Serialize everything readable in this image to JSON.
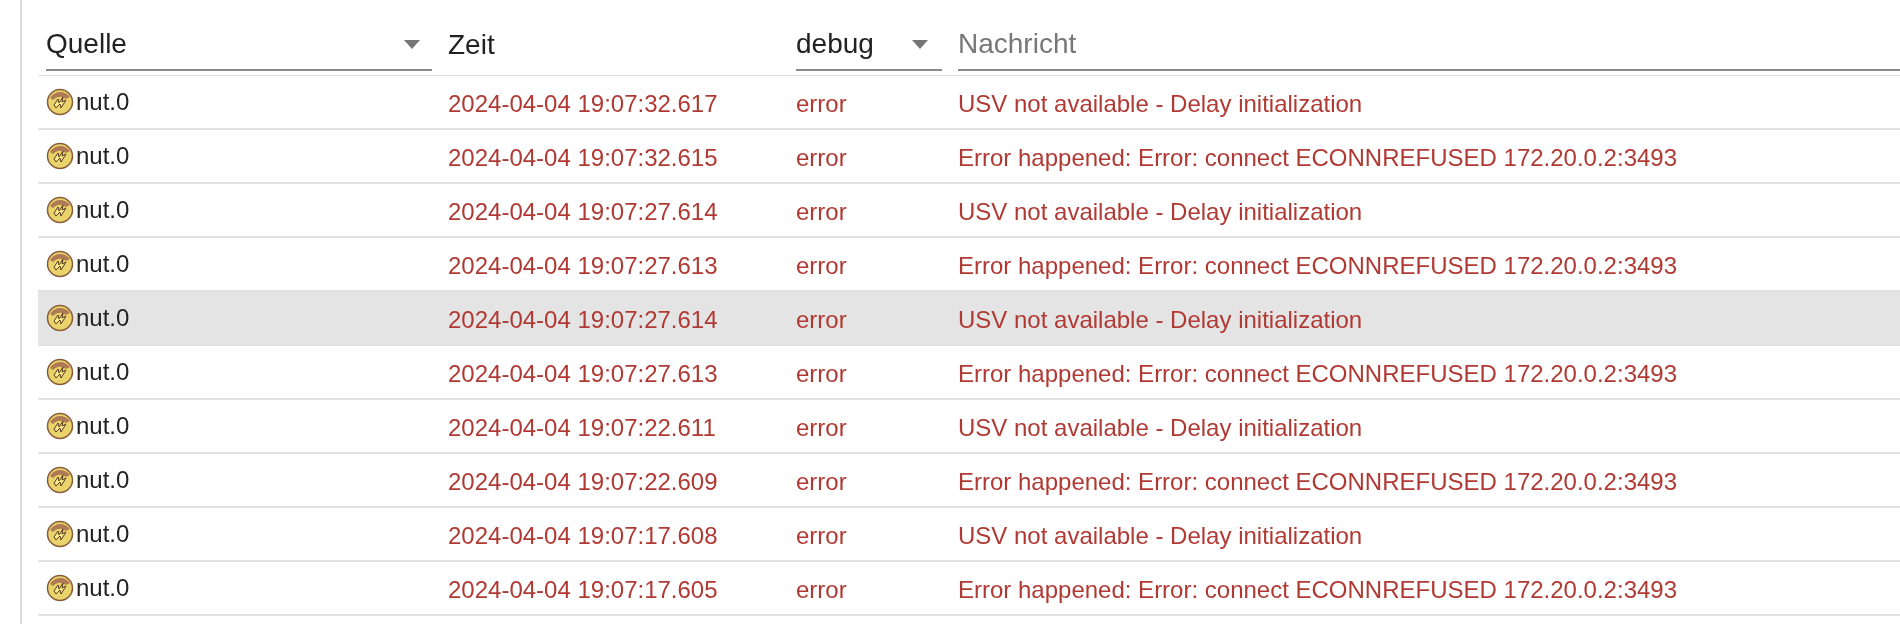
{
  "filters": {
    "source": {
      "value": "Quelle"
    },
    "time": {
      "label": "Zeit"
    },
    "severity": {
      "value": "debug"
    },
    "message": {
      "placeholder": "Nachricht"
    }
  },
  "rows": [
    {
      "source": "nut.0",
      "time": "2024-04-04 19:07:32.617",
      "severity": "error",
      "message": "USV not available - Delay initialization",
      "selected": false
    },
    {
      "source": "nut.0",
      "time": "2024-04-04 19:07:32.615",
      "severity": "error",
      "message": "Error happened: Error: connect ECONNREFUSED 172.20.0.2:3493",
      "selected": false
    },
    {
      "source": "nut.0",
      "time": "2024-04-04 19:07:27.614",
      "severity": "error",
      "message": "USV not available - Delay initialization",
      "selected": false
    },
    {
      "source": "nut.0",
      "time": "2024-04-04 19:07:27.613",
      "severity": "error",
      "message": "Error happened: Error: connect ECONNREFUSED 172.20.0.2:3493",
      "selected": false
    },
    {
      "source": "nut.0",
      "time": "2024-04-04 19:07:27.614",
      "severity": "error",
      "message": "USV not available - Delay initialization",
      "selected": true
    },
    {
      "source": "nut.0",
      "time": "2024-04-04 19:07:27.613",
      "severity": "error",
      "message": "Error happened: Error: connect ECONNREFUSED 172.20.0.2:3493",
      "selected": false
    },
    {
      "source": "nut.0",
      "time": "2024-04-04 19:07:22.611",
      "severity": "error",
      "message": "USV not available - Delay initialization",
      "selected": false
    },
    {
      "source": "nut.0",
      "time": "2024-04-04 19:07:22.609",
      "severity": "error",
      "message": "Error happened: Error: connect ECONNREFUSED 172.20.0.2:3493",
      "selected": false
    },
    {
      "source": "nut.0",
      "time": "2024-04-04 19:07:17.608",
      "severity": "error",
      "message": "USV not available - Delay initialization",
      "selected": false
    },
    {
      "source": "nut.0",
      "time": "2024-04-04 19:07:17.605",
      "severity": "error",
      "message": "Error happened: Error: connect ECONNREFUSED 172.20.0.2:3493",
      "selected": false
    }
  ]
}
